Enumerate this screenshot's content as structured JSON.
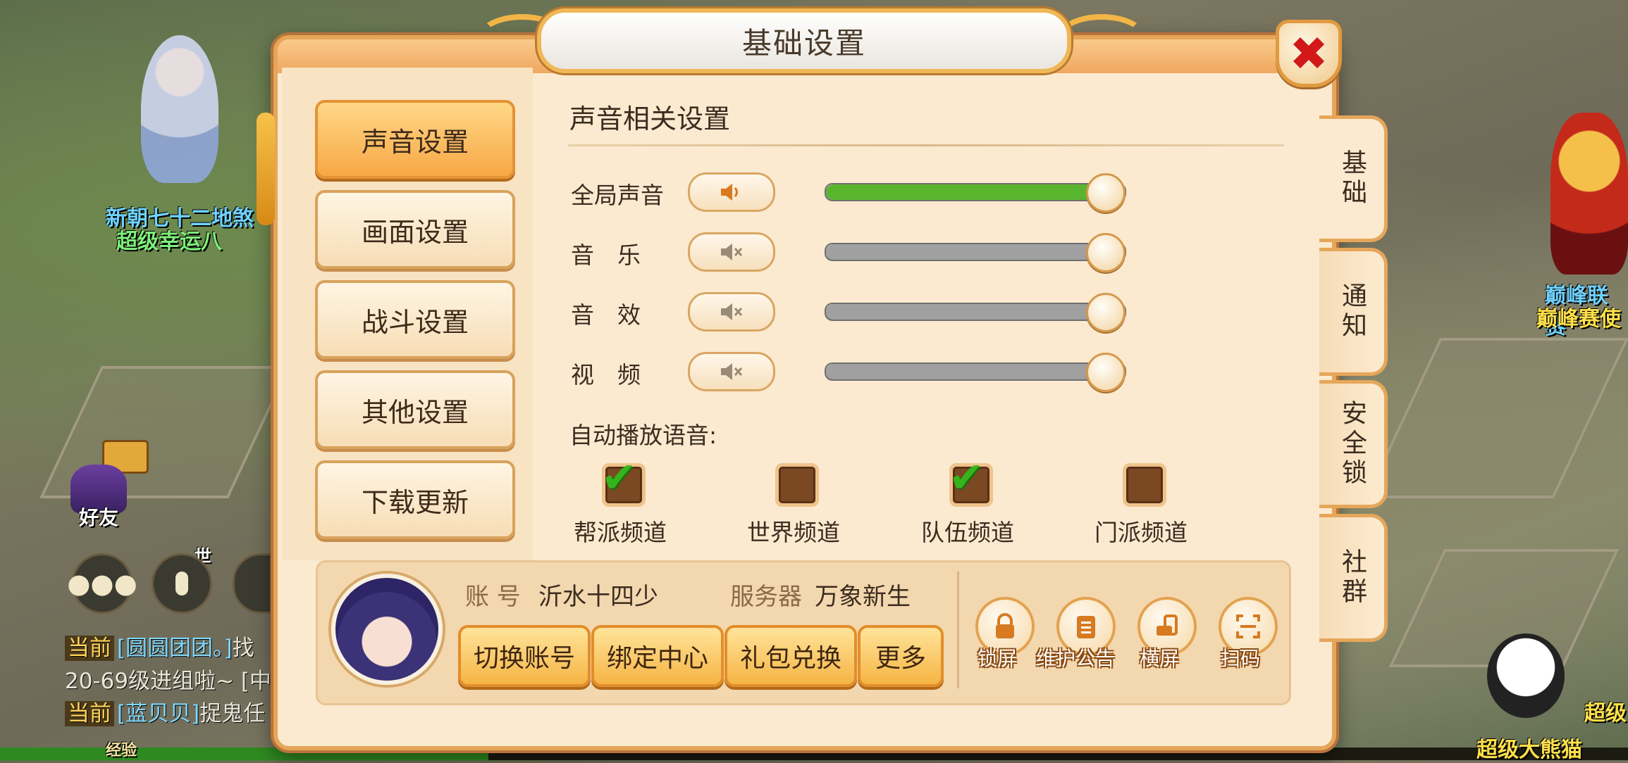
{
  "dialog": {
    "title": "基础设置"
  },
  "nav": [
    {
      "label": "声音设置",
      "active": true
    },
    {
      "label": "画面设置"
    },
    {
      "label": "战斗设置"
    },
    {
      "label": "其他设置"
    },
    {
      "label": "下载更新"
    }
  ],
  "sound": {
    "section_title": "声音相关设置",
    "rows": [
      {
        "label": "全局声音",
        "icon": "speaker-on-icon",
        "level": 1.0,
        "fill_color": "#5ab52e"
      },
      {
        "label": "音　乐",
        "icon": "speaker-muted-icon",
        "level": 1.0,
        "fill_color": "#a0a0a0"
      },
      {
        "label": "音　效",
        "icon": "speaker-muted-icon",
        "level": 1.0,
        "fill_color": "#a0a0a0"
      },
      {
        "label": "视　频",
        "icon": "speaker-muted-icon",
        "level": 1.0,
        "fill_color": "#a0a0a0"
      }
    ],
    "auto_play_label": "自动播放语音:",
    "channels": [
      {
        "label": "帮派频道",
        "checked": true
      },
      {
        "label": "世界频道",
        "checked": false
      },
      {
        "label": "队伍频道",
        "checked": true
      },
      {
        "label": "门派频道",
        "checked": false
      }
    ]
  },
  "account": {
    "account_label": "账 号",
    "account_name": "沂水十四少",
    "server_label": "服务器",
    "server_name": "万象新生",
    "buttons": [
      "切换账号",
      "绑定中心",
      "礼包兑换",
      "更多"
    ],
    "quick_icons": [
      {
        "label": "锁屏",
        "icon": "lock-icon"
      },
      {
        "label": "维护公告",
        "icon": "notice-board-icon"
      },
      {
        "label": "横屏",
        "icon": "rotate-screen-icon"
      },
      {
        "label": "扫码",
        "icon": "scan-code-icon"
      }
    ]
  },
  "side_tabs": [
    {
      "label": "基础",
      "active": true
    },
    {
      "label": "通知"
    },
    {
      "label": "安全锁"
    },
    {
      "label": "社群"
    }
  ],
  "background": {
    "player_title": "超级幸运八",
    "player_name": "新朝七十二地煞",
    "friends_label": "好友",
    "world_label": "世",
    "right_name_1": "巅峰联赛",
    "right_name_2": "巅峰赛使",
    "right_name_3": "超级",
    "pet_name": "超级大熊猫",
    "exp_label": "经验",
    "chat": [
      {
        "channel": "当前",
        "name": "[圆圆团团。]",
        "text": "找"
      },
      {
        "channel": "",
        "name": "",
        "text": "20-69级进组啦~ [中"
      },
      {
        "channel": "当前",
        "name": "[蓝贝贝]",
        "text": "捉鬼任"
      }
    ]
  },
  "colors": {
    "accent_orange": "#f7a745",
    "frame": "#e6a65a",
    "close_x": "#d21818",
    "check_green": "#35b41c"
  }
}
